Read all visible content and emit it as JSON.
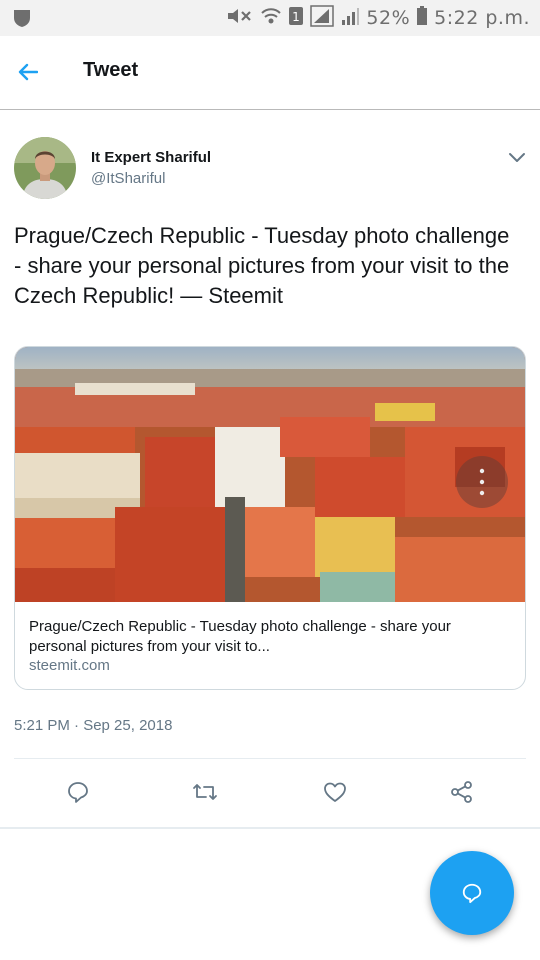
{
  "status_bar": {
    "battery": "52%",
    "time": "5:22 p.m."
  },
  "header": {
    "title": "Tweet"
  },
  "tweet": {
    "author_name": "It Expert Shariful",
    "author_handle": "@ItShariful",
    "text": "Prague/Czech Republic - Tuesday photo challenge - share your personal pictures from your visit to the Czech Republic! — Steemit",
    "card": {
      "title": "Prague/Czech Republic - Tuesday photo challenge - share your personal pictures from your visit to...",
      "domain": "steemit.com"
    },
    "timestamp": "5:21 PM · Sep 25, 2018"
  },
  "actions": [
    "reply-icon",
    "retweet-icon",
    "like-icon",
    "share-icon"
  ],
  "colors": {
    "accent": "#1da1f2",
    "secondary_text": "#657786",
    "primary_text": "#14171a"
  }
}
